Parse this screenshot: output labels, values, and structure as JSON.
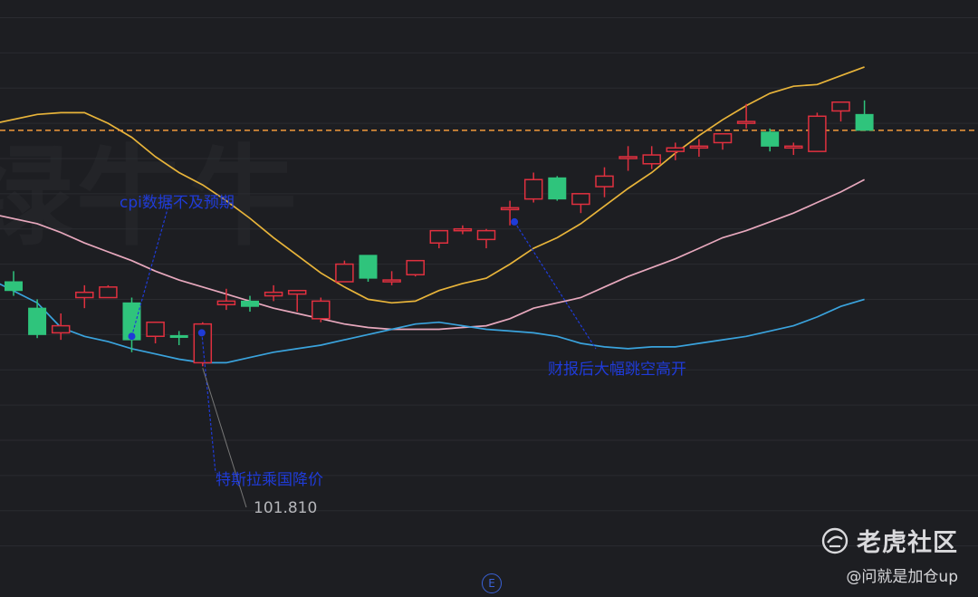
{
  "background_watermark": "绿牛牛",
  "watermark": {
    "brand": "老虎社区",
    "user": "@问就是加仓up"
  },
  "price_label": "101.810",
  "event_marker": "E",
  "annotations": [
    {
      "text": "cpi数据不及预期"
    },
    {
      "text": "特斯拉乘国降价"
    },
    {
      "text": "财报后大幅跳空高开"
    }
  ],
  "colors": {
    "background": "#1d1e22",
    "up": "#e0303f",
    "down": "#2fc47c",
    "upper_band": "#e8b43a",
    "middle_band": "#e7a8bd",
    "lower_band": "#3aa3dd",
    "reference_line": "#f19a3c",
    "annotation": "#1f3bd8",
    "grid": "#2a2b30"
  },
  "chart_data": {
    "type": "candlestick",
    "title": "",
    "xlabel": "",
    "ylabel": "",
    "ylim": [
      97.5,
      113.5
    ],
    "grid": true,
    "reference_line": 109.8,
    "price_label_value": 101.81,
    "candles": [
      {
        "o": 105.5,
        "h": 105.8,
        "l": 105.1,
        "c": 105.25
      },
      {
        "o": 104.75,
        "h": 105.0,
        "l": 103.9,
        "c": 104.0
      },
      {
        "o": 104.05,
        "h": 104.6,
        "l": 103.85,
        "c": 104.25
      },
      {
        "o": 105.05,
        "h": 105.4,
        "l": 104.75,
        "c": 105.2
      },
      {
        "o": 105.05,
        "h": 105.4,
        "l": 105.05,
        "c": 105.35
      },
      {
        "o": 104.9,
        "h": 105.05,
        "l": 103.5,
        "c": 103.85
      },
      {
        "o": 103.95,
        "h": 104.35,
        "l": 103.75,
        "c": 104.35
      },
      {
        "o": 103.97,
        "h": 104.1,
        "l": 103.7,
        "c": 103.95
      },
      {
        "o": 103.2,
        "h": 104.35,
        "l": 103.1,
        "c": 104.3
      },
      {
        "o": 104.85,
        "h": 105.3,
        "l": 104.7,
        "c": 104.95
      },
      {
        "o": 104.95,
        "h": 105.1,
        "l": 104.65,
        "c": 104.8
      },
      {
        "o": 105.1,
        "h": 105.4,
        "l": 104.95,
        "c": 105.2
      },
      {
        "o": 105.15,
        "h": 105.25,
        "l": 104.65,
        "c": 105.25
      },
      {
        "o": 104.45,
        "h": 105.05,
        "l": 104.35,
        "c": 104.95
      },
      {
        "o": 105.5,
        "h": 106.1,
        "l": 105.5,
        "c": 106.0
      },
      {
        "o": 106.25,
        "h": 106.25,
        "l": 105.5,
        "c": 105.6
      },
      {
        "o": 105.55,
        "h": 105.8,
        "l": 105.4,
        "c": 105.55
      },
      {
        "o": 105.7,
        "h": 106.1,
        "l": 105.65,
        "c": 106.1
      },
      {
        "o": 106.6,
        "h": 106.9,
        "l": 106.45,
        "c": 106.95
      },
      {
        "o": 106.95,
        "h": 107.1,
        "l": 106.85,
        "c": 107.0
      },
      {
        "o": 106.7,
        "h": 107.0,
        "l": 106.45,
        "c": 106.95
      },
      {
        "o": 107.55,
        "h": 107.8,
        "l": 107.1,
        "c": 107.6
      },
      {
        "o": 107.85,
        "h": 108.6,
        "l": 107.75,
        "c": 108.4
      },
      {
        "o": 108.45,
        "h": 108.5,
        "l": 107.8,
        "c": 107.85
      },
      {
        "o": 107.7,
        "h": 108.0,
        "l": 107.45,
        "c": 108.0
      },
      {
        "o": 108.2,
        "h": 108.75,
        "l": 107.9,
        "c": 108.5
      },
      {
        "o": 109.0,
        "h": 109.35,
        "l": 108.65,
        "c": 109.05
      },
      {
        "o": 108.85,
        "h": 109.35,
        "l": 108.7,
        "c": 109.1
      },
      {
        "o": 109.2,
        "h": 109.45,
        "l": 108.95,
        "c": 109.3
      },
      {
        "o": 109.3,
        "h": 109.55,
        "l": 109.05,
        "c": 109.35
      },
      {
        "o": 109.45,
        "h": 109.6,
        "l": 109.25,
        "c": 109.7
      },
      {
        "o": 110.05,
        "h": 110.55,
        "l": 109.85,
        "c": 110.05
      },
      {
        "o": 109.75,
        "h": 109.85,
        "l": 109.2,
        "c": 109.35
      },
      {
        "o": 109.35,
        "h": 109.45,
        "l": 109.1,
        "c": 109.35
      },
      {
        "o": 109.2,
        "h": 110.3,
        "l": 109.2,
        "c": 110.2
      },
      {
        "o": 110.35,
        "h": 110.5,
        "l": 110.05,
        "c": 110.6
      },
      {
        "o": 110.25,
        "h": 110.65,
        "l": 109.8,
        "c": 109.8
      }
    ],
    "series": [
      {
        "key": "upper_band",
        "values": [
          110.0,
          110.25,
          110.3,
          110.3,
          110.0,
          109.6,
          109.05,
          108.6,
          108.25,
          107.8,
          107.3,
          106.75,
          106.25,
          105.75,
          105.35,
          105.0,
          104.9,
          104.95,
          105.25,
          105.45,
          105.6,
          106.0,
          106.45,
          106.75,
          107.15,
          107.65,
          108.15,
          108.6,
          109.15,
          109.65,
          110.1,
          110.5,
          110.85,
          111.05,
          111.1,
          111.35,
          111.6
        ]
      },
      {
        "key": "middle_band",
        "values": [
          107.4,
          107.15,
          106.9,
          106.6,
          106.35,
          106.1,
          105.8,
          105.55,
          105.35,
          105.15,
          104.95,
          104.75,
          104.6,
          104.45,
          104.3,
          104.2,
          104.15,
          104.15,
          104.15,
          104.2,
          104.25,
          104.45,
          104.75,
          104.9,
          105.05,
          105.35,
          105.65,
          105.9,
          106.15,
          106.45,
          106.75,
          106.95,
          107.2,
          107.45,
          107.75,
          108.05,
          108.4
        ]
      },
      {
        "key": "lower_band",
        "values": [
          105.5,
          104.9,
          104.2,
          103.95,
          103.8,
          103.6,
          103.45,
          103.3,
          103.2,
          103.2,
          103.35,
          103.5,
          103.6,
          103.7,
          103.85,
          104.0,
          104.15,
          104.3,
          104.35,
          104.25,
          104.15,
          104.1,
          104.05,
          103.95,
          103.75,
          103.65,
          103.6,
          103.65,
          103.65,
          103.75,
          103.85,
          103.95,
          104.1,
          104.25,
          104.5,
          104.8,
          105.0
        ]
      }
    ]
  }
}
